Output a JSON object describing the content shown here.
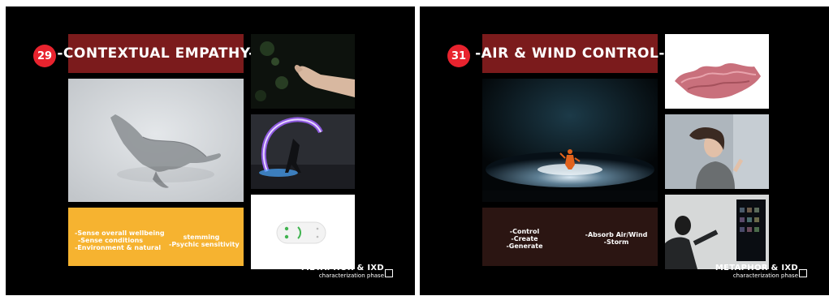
{
  "slides": [
    {
      "number": "29",
      "title": "-CONTEXTUAL EMPATHY-",
      "info_left": [
        "-Sense overall wellbeing",
        "-Sense conditions",
        "-Environment & natural"
      ],
      "info_right": [
        "stemming",
        "-Psychic sensitivity"
      ],
      "footer_title": "METAPHOR & IXD",
      "footer_sub": "characterization phase",
      "colors": {
        "number_bg": "#e8232e",
        "title_bg": "#7b1b1c",
        "info_bg": "#f6b330"
      }
    },
    {
      "number": "31",
      "title": "-AIR & WIND CONTROL-",
      "info_left": [
        "-Control",
        "-Create",
        "-Generate"
      ],
      "info_right": [
        "-Absorb Air/Wind",
        "-Storm"
      ],
      "footer_title": "METAPHOR & IXD",
      "footer_sub": "characterization phase",
      "colors": {
        "number_bg": "#e8232e",
        "title_bg": "#7b1b1c",
        "info_bg": "#2b1512"
      }
    }
  ]
}
